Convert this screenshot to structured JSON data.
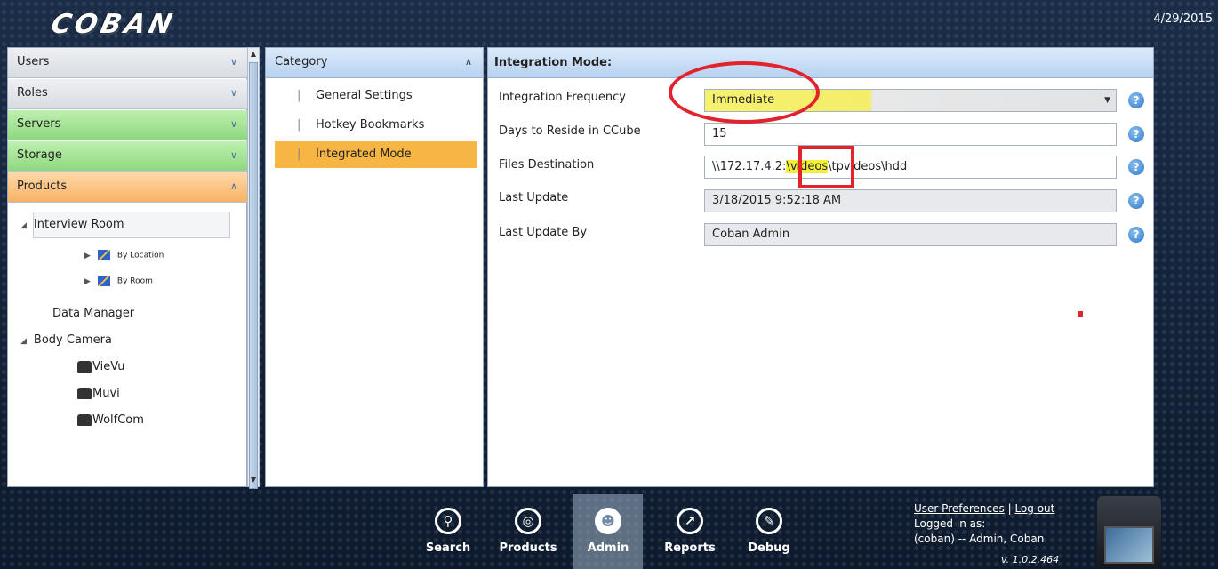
{
  "header": {
    "logo": "COBAN",
    "date": "4/29/2015"
  },
  "nav": {
    "sections": [
      {
        "label": "Users",
        "style": "gray",
        "expanded": false
      },
      {
        "label": "Roles",
        "style": "gray",
        "expanded": false
      },
      {
        "label": "Servers",
        "style": "green",
        "expanded": false
      },
      {
        "label": "Storage",
        "style": "green",
        "expanded": false
      },
      {
        "label": "Products",
        "style": "orange",
        "expanded": true
      }
    ],
    "tree": {
      "interview_room": "Interview Room",
      "by_location": "By Location",
      "by_room": "By Room",
      "data_manager": "Data Manager",
      "body_camera": "Body Camera",
      "vievu": "VieVu",
      "muvi": "Muvi",
      "wolfcom": "WolfCom"
    }
  },
  "category": {
    "header": "Category",
    "items": [
      "General Settings",
      "Hotkey Bookmarks",
      "Integrated Mode"
    ],
    "active": "Integrated Mode"
  },
  "main": {
    "header": "Integration Mode:",
    "fields": {
      "frequency": {
        "label": "Integration Frequency",
        "value": "Immediate"
      },
      "days": {
        "label": "Days to Reside in CCube",
        "value": "15"
      },
      "destination": {
        "label": "Files Destination",
        "value_pre": "\\\\172.17.4.2:",
        "value_hl": "\\videos",
        "value_post": "\\tpvideos\\hdd"
      },
      "last_update": {
        "label": "Last Update",
        "value": "3/18/2015 9:52:18 AM"
      },
      "last_update_by": {
        "label": "Last Update By",
        "value": "Coban Admin"
      }
    },
    "help_glyph": "?"
  },
  "bottom": {
    "tabs": [
      {
        "label": "Search",
        "icon": "search-icon",
        "glyph": "⚲"
      },
      {
        "label": "Products",
        "icon": "target-icon",
        "glyph": "◎"
      },
      {
        "label": "Admin",
        "icon": "user-icon",
        "glyph": "☻"
      },
      {
        "label": "Reports",
        "icon": "chart-icon",
        "glyph": "↗"
      },
      {
        "label": "Debug",
        "icon": "wrench-icon",
        "glyph": "✎"
      }
    ],
    "active_tab": "Admin",
    "user_prefs": "User Preferences",
    "separator": "|",
    "logout": "Log out",
    "logged_in_label": "Logged in as:",
    "logged_in_user": "(coban) -- Admin, Coban",
    "version": "v. 1.0.2.464"
  }
}
